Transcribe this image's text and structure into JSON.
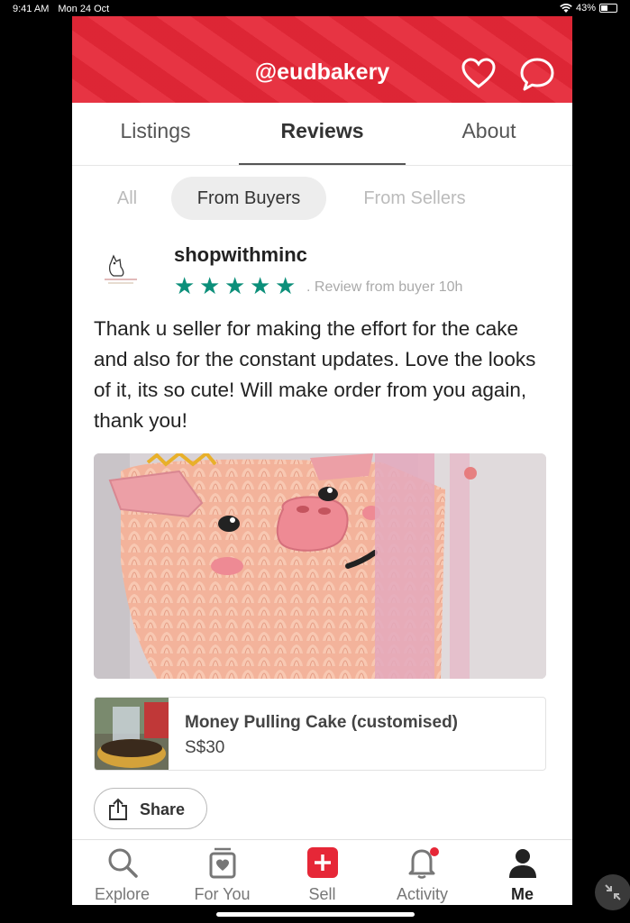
{
  "status_bar": {
    "time": "9:41 AM",
    "date": "Mon 24 Oct",
    "battery": "43%"
  },
  "header": {
    "handle": "@eudbakery",
    "brand_color": "#e62737"
  },
  "main_tabs": [
    {
      "label": "Listings",
      "active": false
    },
    {
      "label": "Reviews",
      "active": true
    },
    {
      "label": "About",
      "active": false
    }
  ],
  "sub_tabs": [
    {
      "label": "All",
      "active": false
    },
    {
      "label": "From Buyers",
      "active": true
    },
    {
      "label": "From Sellers",
      "active": false
    }
  ],
  "review": {
    "reviewer": "shopwithminc",
    "rating": 5,
    "meta": ". Review from buyer 10h",
    "text": "Thank u seller for making the effort for the cake and also for the constant updates. Love the looks of it, its so cute! Will make order from you again, thank you!",
    "star_color": "#0c8f7a"
  },
  "listing": {
    "title": "Money Pulling Cake (customised)",
    "price": "S$30"
  },
  "share_label": "Share",
  "bottom_nav": [
    {
      "label": "Explore",
      "icon": "search-icon",
      "active": false
    },
    {
      "label": "For You",
      "icon": "gift-icon",
      "active": false
    },
    {
      "label": "Sell",
      "icon": "plus-icon",
      "active": false
    },
    {
      "label": "Activity",
      "icon": "bell-icon",
      "active": false
    },
    {
      "label": "Me",
      "icon": "person-icon",
      "active": true
    }
  ]
}
